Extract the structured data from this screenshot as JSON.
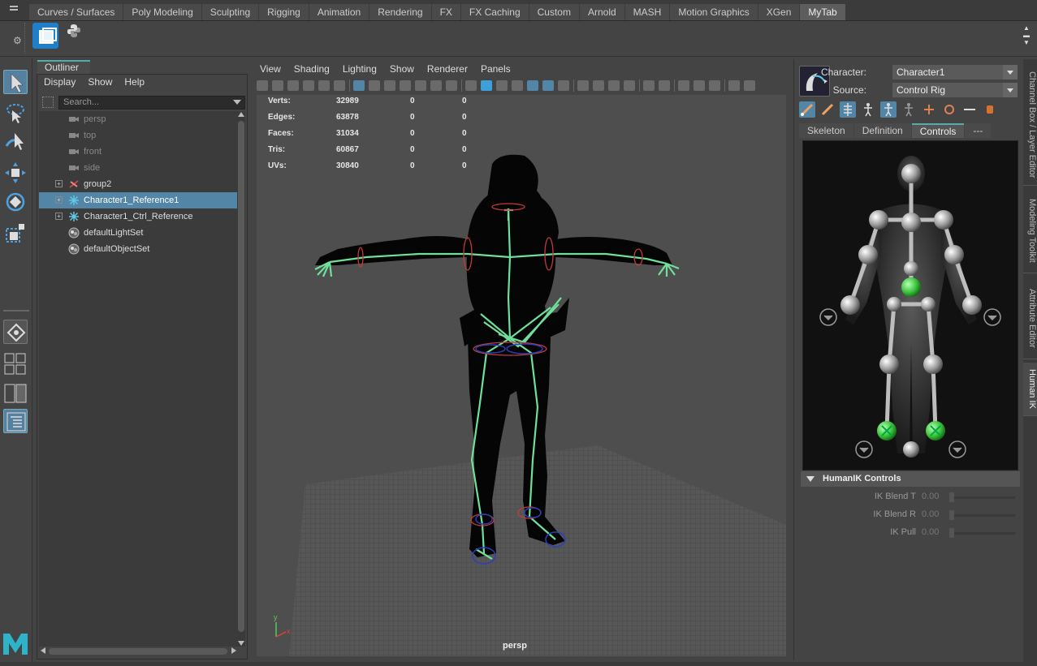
{
  "shelf_tabs": [
    "Curves / Surfaces",
    "Poly Modeling",
    "Sculpting",
    "Rigging",
    "Animation",
    "Rendering",
    "FX",
    "FX Caching",
    "Custom",
    "Arnold",
    "MASH",
    "Motion Graphics",
    "XGen",
    "MyTab"
  ],
  "active_shelf_tab": "MyTab",
  "outliner": {
    "tab_label": "Outliner",
    "menu": {
      "display": "Display",
      "show": "Show",
      "help": "Help"
    },
    "search_placeholder": "Search...",
    "items": [
      {
        "label": "persp",
        "icon": "camera-icon",
        "dimmed": true
      },
      {
        "label": "top",
        "icon": "camera-icon",
        "dimmed": true
      },
      {
        "label": "front",
        "icon": "camera-icon",
        "dimmed": true
      },
      {
        "label": "side",
        "icon": "camera-icon",
        "dimmed": true
      },
      {
        "label": "group2",
        "icon": "group-icon",
        "expandable": true
      },
      {
        "label": "Character1_Reference1",
        "icon": "hik-reference-icon",
        "expandable": true,
        "selected": true
      },
      {
        "label": "Character1_Ctrl_Reference",
        "icon": "hik-reference-icon",
        "expandable": true
      },
      {
        "label": "defaultLightSet",
        "icon": "set-icon"
      },
      {
        "label": "defaultObjectSet",
        "icon": "set-icon"
      }
    ]
  },
  "viewport": {
    "menu": {
      "view": "View",
      "shading": "Shading",
      "lighting": "Lighting",
      "show": "Show",
      "renderer": "Renderer",
      "panels": "Panels"
    },
    "hud": [
      {
        "label": "Verts:",
        "v1": "32989",
        "v2": "0",
        "v3": "0"
      },
      {
        "label": "Edges:",
        "v1": "63878",
        "v2": "0",
        "v3": "0"
      },
      {
        "label": "Faces:",
        "v1": "31034",
        "v2": "0",
        "v3": "0"
      },
      {
        "label": "Tris:",
        "v1": "60867",
        "v2": "0",
        "v3": "0"
      },
      {
        "label": "UVs:",
        "v1": "30840",
        "v2": "0",
        "v3": "0"
      }
    ],
    "camera_name": "persp",
    "axis": {
      "x": "x",
      "y": "y"
    }
  },
  "humanik": {
    "character_label": "Character:",
    "character_value": "Character1",
    "source_label": "Source:",
    "source_value": "Control Rig",
    "tabs": [
      "Skeleton",
      "Definition",
      "Controls",
      "---"
    ],
    "active_tab": "Controls",
    "section_title": "HumanIK Controls",
    "sliders": [
      {
        "label": "IK Blend T",
        "value": "0.00"
      },
      {
        "label": "IK Blend R",
        "value": "0.00"
      },
      {
        "label": "IK Pull",
        "value": "0.00"
      }
    ]
  },
  "side_tabs": [
    "Channel Box / Layer Editor",
    "Modeling Toolkit",
    "Attribute Editor",
    "Human IK"
  ],
  "active_side_tab": "Human IK",
  "colors": {
    "accent": "#5285a6",
    "skeleton": "#6fe09a",
    "ik_green": "#3cc43c",
    "orange": "#d8712e"
  }
}
